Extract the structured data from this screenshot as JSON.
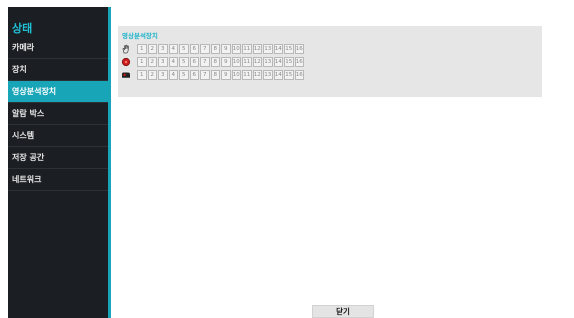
{
  "sidebar": {
    "title": "상태",
    "items": [
      {
        "label": "카메라",
        "active": false
      },
      {
        "label": "장치",
        "active": false
      },
      {
        "label": "영상분석장치",
        "active": true
      },
      {
        "label": "알람 박스",
        "active": false
      },
      {
        "label": "시스템",
        "active": false
      },
      {
        "label": "저장 공간",
        "active": false
      },
      {
        "label": "네트워크",
        "active": false
      }
    ]
  },
  "panel": {
    "title": "영상분석장치",
    "rows": [
      {
        "icon": "hand-wave-icon",
        "cells": [
          "1",
          "2",
          "3",
          "4",
          "5",
          "6",
          "7",
          "8",
          "9",
          "10",
          "11",
          "12",
          "13",
          "14",
          "15",
          "16"
        ]
      },
      {
        "icon": "record-icon",
        "cells": [
          "1",
          "2",
          "3",
          "4",
          "5",
          "6",
          "7",
          "8",
          "9",
          "10",
          "11",
          "12",
          "13",
          "14",
          "15",
          "16"
        ]
      },
      {
        "icon": "camera-icon",
        "cells": [
          "1",
          "2",
          "3",
          "4",
          "5",
          "6",
          "7",
          "8",
          "9",
          "10",
          "11",
          "12",
          "13",
          "14",
          "15",
          "16"
        ]
      }
    ]
  },
  "footer": {
    "close_label": "닫기"
  },
  "colors": {
    "accent": "#18a5b8",
    "sidebar_bg": "#1b1f23",
    "panel_bg": "#e6e6e6"
  }
}
